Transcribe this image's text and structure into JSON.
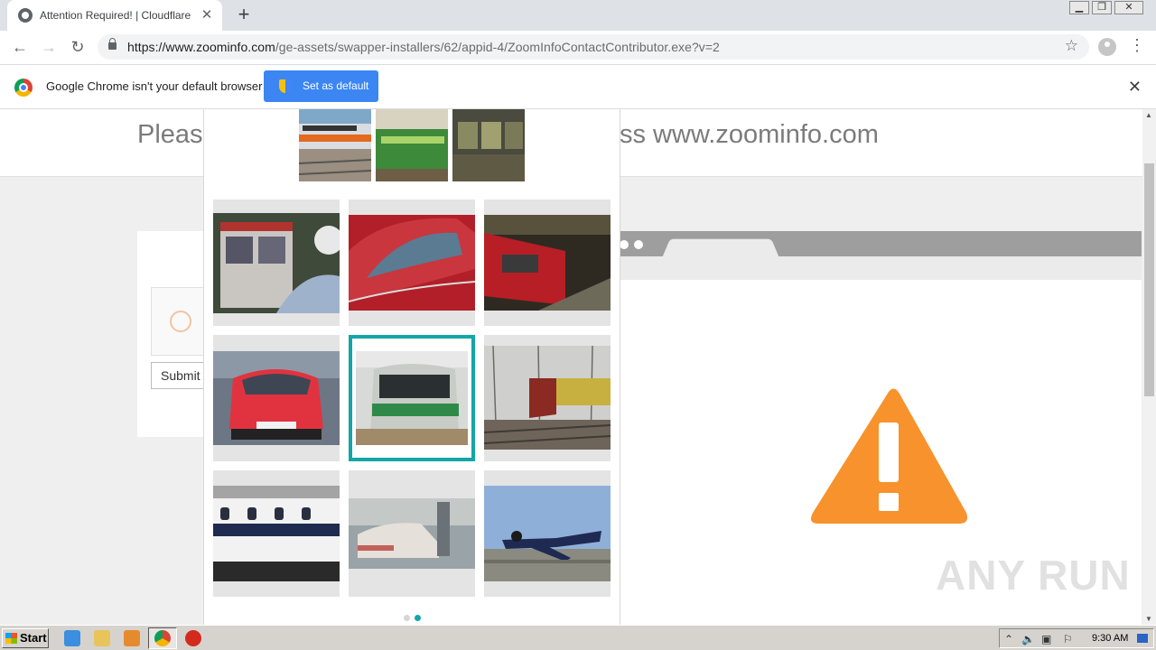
{
  "tab": {
    "title": "Attention Required! | Cloudflare",
    "favicon": "globe-icon"
  },
  "toolbar": {
    "url_domain": "https://www.zoominfo.com",
    "url_path": "/ge-assets/swapper-installers/62/appid-4/ZoomInfoContactContributor.exe?v=2"
  },
  "infobar": {
    "message": "Google Chrome isn't your default browser",
    "button_label": "Set as default"
  },
  "page": {
    "header_left": "Please",
    "header_right": "ss www.zoominfo.com",
    "submit_label": "Submit"
  },
  "challenge": {
    "examples": [
      "train-orange",
      "train-green",
      "train-interior"
    ],
    "tiles": [
      {
        "subject": "bus",
        "selected": false
      },
      {
        "subject": "red-car",
        "selected": false
      },
      {
        "subject": "train-platform",
        "selected": false
      },
      {
        "subject": "red-hatchback",
        "selected": false
      },
      {
        "subject": "green-train",
        "selected": true
      },
      {
        "subject": "freight-train",
        "selected": false
      },
      {
        "subject": "train-side",
        "selected": false
      },
      {
        "subject": "faded-car",
        "selected": false
      },
      {
        "subject": "airplane",
        "selected": false
      }
    ],
    "pager": {
      "pages": 2,
      "current": 2
    }
  },
  "watermark": "ANY RUN",
  "taskbar": {
    "start_label": "Start",
    "clock": "9:30 AM"
  },
  "colors": {
    "accent": "#3b86f2",
    "selection": "#14a6a6",
    "warning": "#f7922d"
  }
}
